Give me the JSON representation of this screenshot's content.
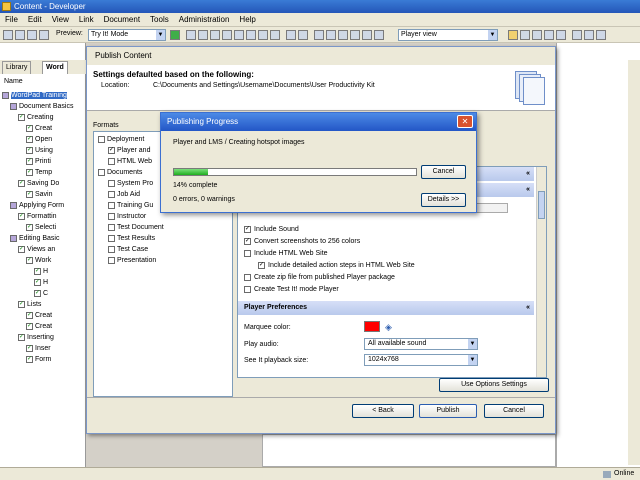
{
  "window": {
    "title": "Content - Developer"
  },
  "menu": [
    "File",
    "Edit",
    "View",
    "Link",
    "Document",
    "Tools",
    "Administration",
    "Help"
  ],
  "toolbar": {
    "preview_label": "Preview:",
    "preview_mode": "Try It! Mode",
    "view_mode": "Player view"
  },
  "left_tabs": {
    "library": "Library",
    "word": "Word"
  },
  "tree": {
    "header": "Name",
    "items": [
      {
        "label": "WordPad Training",
        "indent": 0,
        "check": false
      },
      {
        "label": "Document Basics",
        "indent": 1,
        "check": false
      },
      {
        "label": "Creating",
        "indent": 2,
        "check": true
      },
      {
        "label": "Creat",
        "indent": 3,
        "check": true
      },
      {
        "label": "Open",
        "indent": 3,
        "check": true
      },
      {
        "label": "Using",
        "indent": 3,
        "check": true
      },
      {
        "label": "Printi",
        "indent": 3,
        "check": true
      },
      {
        "label": "Temp",
        "indent": 3,
        "check": true
      },
      {
        "label": "Saving Do",
        "indent": 2,
        "check": true
      },
      {
        "label": "Savin",
        "indent": 3,
        "check": true
      },
      {
        "label": "Applying Form",
        "indent": 1,
        "check": false
      },
      {
        "label": "Formattin",
        "indent": 2,
        "check": true
      },
      {
        "label": "Selecti",
        "indent": 3,
        "check": true
      },
      {
        "label": "Editing Basic",
        "indent": 1,
        "check": false
      },
      {
        "label": "Views an",
        "indent": 2,
        "check": true
      },
      {
        "label": "Work",
        "indent": 3,
        "check": true
      },
      {
        "label": "H",
        "indent": 4,
        "check": true
      },
      {
        "label": "H",
        "indent": 4,
        "check": true
      },
      {
        "label": "C",
        "indent": 4,
        "check": true
      },
      {
        "label": "Lists",
        "indent": 2,
        "check": true
      },
      {
        "label": "Creat",
        "indent": 3,
        "check": true
      },
      {
        "label": "Creat",
        "indent": 3,
        "check": true
      },
      {
        "label": "Inserting",
        "indent": 2,
        "check": true
      },
      {
        "label": "Inser",
        "indent": 3,
        "check": true
      },
      {
        "label": "Form",
        "indent": 3,
        "check": true
      }
    ]
  },
  "dialog": {
    "title": "Publish Content",
    "heading": "Settings defaulted based on the following:",
    "location_label": "Location:",
    "location_value": "C:\\Documents and Settings\\Username\\Documents\\User Productivity Kit",
    "formats_label": "Formats",
    "formats": [
      {
        "label": "Deployment",
        "indent": 0,
        "checked": false
      },
      {
        "label": "Player and",
        "indent": 1,
        "checked": true
      },
      {
        "label": "HTML Web",
        "indent": 1,
        "checked": false
      },
      {
        "label": "Documents",
        "indent": 0,
        "checked": false
      },
      {
        "label": "System Pro",
        "indent": 1,
        "checked": false
      },
      {
        "label": "Job Aid",
        "indent": 1,
        "checked": false
      },
      {
        "label": "Training Gu",
        "indent": 1,
        "checked": false
      },
      {
        "label": "Instructor",
        "indent": 1,
        "checked": false
      },
      {
        "label": "Test Document",
        "indent": 1,
        "checked": false
      },
      {
        "label": "Test Results",
        "indent": 1,
        "checked": false
      },
      {
        "label": "Test Case",
        "indent": 1,
        "checked": false
      },
      {
        "label": "Presentation",
        "indent": 1,
        "checked": false
      }
    ],
    "options": [
      {
        "label": "Include Sound",
        "checked": true,
        "indent": 0
      },
      {
        "label": "Convert screenshots to 256 colors",
        "checked": true,
        "indent": 0
      },
      {
        "label": "Include HTML Web Site",
        "checked": false,
        "indent": 0
      },
      {
        "label": "Include detailed action steps in HTML Web Site",
        "checked": true,
        "indent": 1
      },
      {
        "label": "Create zip file from published Player package",
        "checked": false,
        "indent": 0
      },
      {
        "label": "Create Test It! mode Player",
        "checked": false,
        "indent": 0
      }
    ],
    "player_prefs_title": "Player Preferences",
    "marquee_label": "Marquee color:",
    "marquee_color": "#ff0000",
    "play_audio_label": "Play audio:",
    "play_audio_value": "All available sound",
    "playback_size_label": "See It playback size:",
    "playback_size_value": "1024x768",
    "use_options_button": "Use Options Settings",
    "back_button": "< Back",
    "publish_button": "Publish",
    "cancel_button": "Cancel"
  },
  "progress": {
    "title": "Publishing Progress",
    "message": "Player and LMS / Creating hotspot images",
    "percent": 14,
    "percent_text": "14% complete",
    "errors_text": "0 errors, 0 warnings",
    "cancel_button": "Cancel",
    "details_button": "Details >>"
  },
  "status": {
    "online": "Online"
  }
}
